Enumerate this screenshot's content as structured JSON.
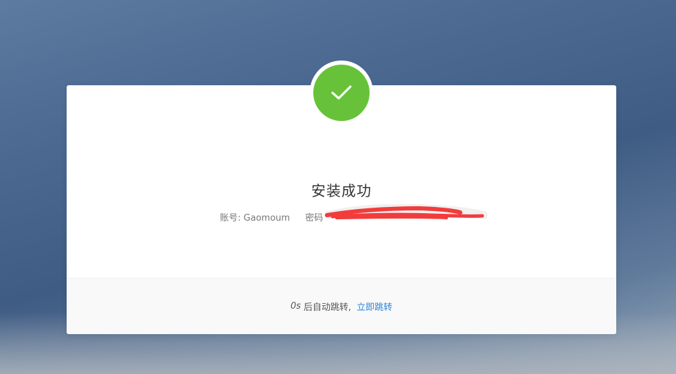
{
  "dialog": {
    "title": "安装成功",
    "account_label": "账号:",
    "account_value": "Gaomoum",
    "password_label": "密码",
    "countdown_seconds": "0s",
    "countdown_text": "后自动跳转,",
    "jump_now_label": "立即跳转"
  },
  "colors": {
    "success": "#67c23a",
    "link": "#2a83d6"
  },
  "icons": {
    "status": "check-icon"
  }
}
